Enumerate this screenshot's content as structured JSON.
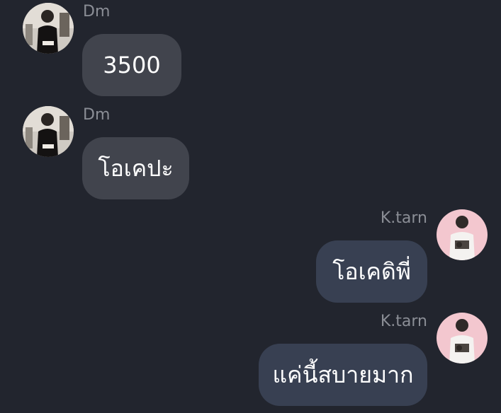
{
  "messages": [
    {
      "sender": "Dm",
      "text": "3500",
      "side": "left",
      "avatar_icon": "dm-avatar"
    },
    {
      "sender": "Dm",
      "text": "โอเคปะ",
      "side": "left",
      "avatar_icon": "dm-avatar"
    },
    {
      "sender": "K.tarn",
      "text": "โอเคดิพี่",
      "side": "right",
      "avatar_icon": "ktarn-avatar"
    },
    {
      "sender": "K.tarn",
      "text": "แค่นี้สบายมาก",
      "side": "right",
      "avatar_icon": "ktarn-avatar"
    }
  ],
  "colors": {
    "background": "#22252e",
    "incoming_bubble": "#41444d",
    "outgoing_bubble": "#384052",
    "sender_name": "#8b8e96",
    "message_text": "#ffffff"
  }
}
